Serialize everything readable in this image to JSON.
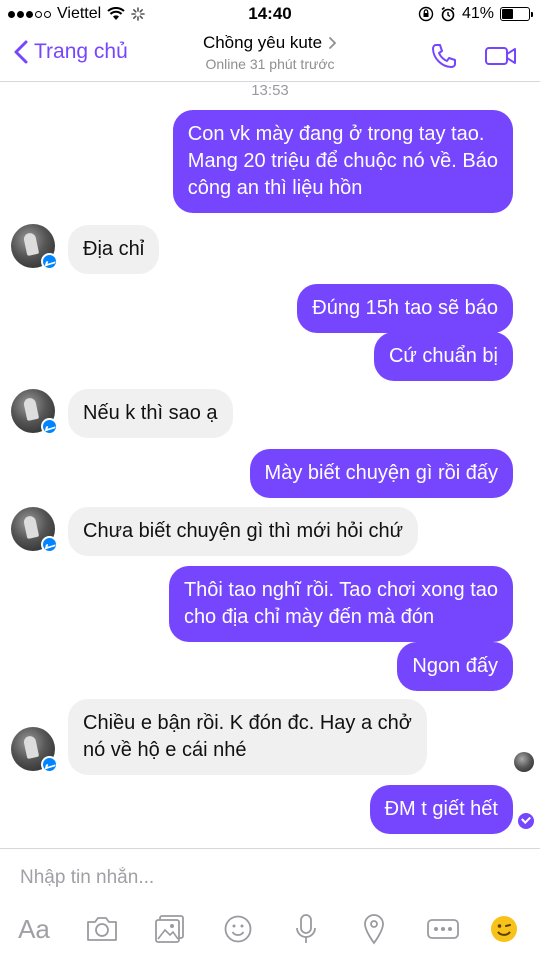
{
  "status_bar": {
    "carrier": "Viettel",
    "time": "14:40",
    "battery": "41%",
    "battery_level": 0.41
  },
  "header": {
    "back_label": "Trang chủ",
    "contact_name": "Chồng yêu kute",
    "presence": "Online 31 phút trước"
  },
  "chat": {
    "timestamp": "13:53",
    "messages": [
      {
        "dir": "out",
        "text": "Con vk mày đang ở trong tay tao.\nMang 20 triệu để chuộc nó về. Báo\ncông an thì liệu hồn"
      },
      {
        "dir": "in",
        "text": "Địa chỉ"
      },
      {
        "dir": "out",
        "text": "Đúng 15h tao sẽ báo"
      },
      {
        "dir": "out",
        "text": "Cứ chuẩn bị"
      },
      {
        "dir": "in",
        "text": "Nếu k thì sao ạ"
      },
      {
        "dir": "out",
        "text": "Mày biết chuyện gì rồi đấy"
      },
      {
        "dir": "in",
        "text": "Chưa biết chuyện gì thì mới hỏi chứ"
      },
      {
        "dir": "out",
        "text": "Thôi tao nghĩ rồi. Tao chơi xong tao\ncho địa chỉ mày đến mà đón"
      },
      {
        "dir": "out",
        "text": "Ngon đấy"
      },
      {
        "dir": "in",
        "text": "Chiều e bận rồi. K đón đc. Hay a chở\nnó về hộ e cái nhé"
      },
      {
        "dir": "out",
        "text": "ĐM t giết hết"
      }
    ]
  },
  "composer": {
    "placeholder": "Nhập tin nhắn...",
    "text_button": "Aa",
    "icons": [
      "text-format-icon",
      "camera-icon",
      "gallery-icon",
      "sticker-icon",
      "microphone-icon",
      "location-icon",
      "more-icon",
      "emoji-icon"
    ]
  },
  "colors": {
    "accent": "#7646ff",
    "incoming_bubble": "#f1f0f0",
    "messenger_badge": "#0084ff"
  }
}
